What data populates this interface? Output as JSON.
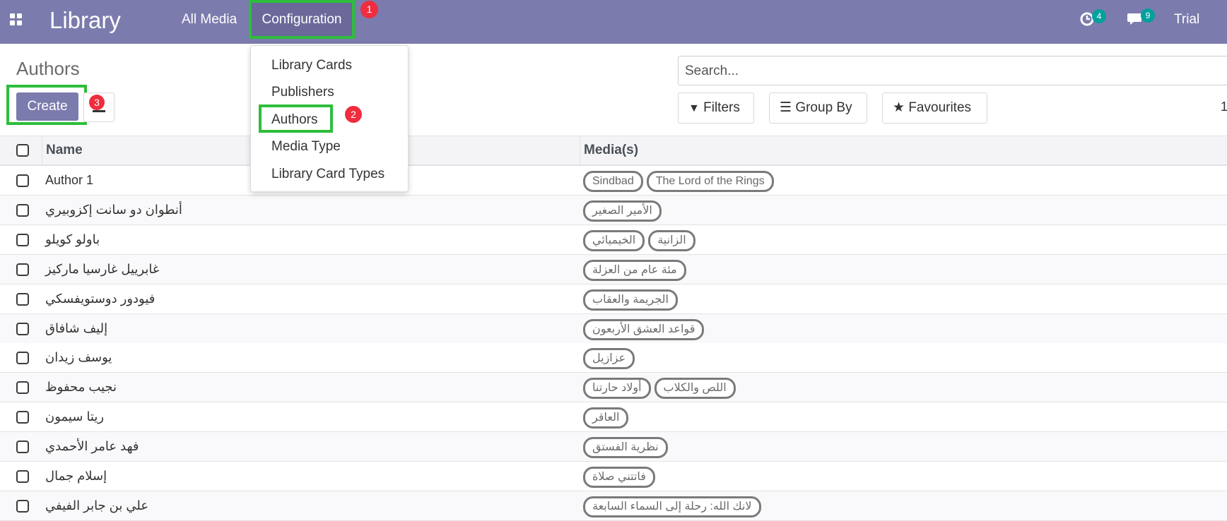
{
  "navbar": {
    "brand": "Library",
    "menu_all_media": "All Media",
    "menu_configuration": "Configuration",
    "activity_count": "4",
    "messages_count": "9",
    "user": "Trial",
    "colors": {
      "bar": "#7c7bad",
      "highlight": "#2ebd3c",
      "marker": "#ef2d3e",
      "badge": "#00a09d"
    }
  },
  "markers": {
    "one": "1",
    "two": "2",
    "three": "3"
  },
  "control_panel": {
    "title": "Authors",
    "create_label": "Create",
    "search_placeholder": "Search...",
    "filters_label": "Filters",
    "group_by_label": "Group By",
    "favourites_label": "Favourites",
    "pager": "1"
  },
  "dropdown": {
    "items": [
      "Library Cards",
      "Publishers",
      "Authors",
      "Media Type",
      "Library Card Types"
    ]
  },
  "table": {
    "columns": [
      "Name",
      "Media(s)"
    ],
    "rows": [
      {
        "name": "Author 1",
        "media": [
          "Sindbad",
          "The Lord of the Rings"
        ]
      },
      {
        "name": "أنطوان دو سانت إكزوبيري",
        "media": [
          "الأمير الصغير"
        ]
      },
      {
        "name": "باولو كويلو",
        "media": [
          "الخيميائي",
          "الزانية"
        ]
      },
      {
        "name": "غابرييل غارسيا ماركيز",
        "media": [
          "مئة عام من العزلة"
        ]
      },
      {
        "name": "فيودور دوستويفسكي",
        "media": [
          "الجريمة والعقاب"
        ]
      },
      {
        "name": "إليف شافاق",
        "media": [
          "قواعد العشق الأربعون"
        ]
      },
      {
        "name": "يوسف زيدان",
        "media": [
          "عزازيل"
        ]
      },
      {
        "name": "نجيب محفوظ",
        "media": [
          "أولاد حارتنا",
          "اللص والكلاب"
        ]
      },
      {
        "name": "ريتا سيمون",
        "media": [
          "العاقر"
        ]
      },
      {
        "name": "فهد عامر الأحمدي",
        "media": [
          "نظرية الفستق"
        ]
      },
      {
        "name": "إسلام جمال",
        "media": [
          "فاتتني صلاة"
        ]
      },
      {
        "name": "علي بن جابر الفيفي",
        "media": [
          "لانك الله: رحلة إلى السماء السابعة"
        ]
      }
    ]
  }
}
